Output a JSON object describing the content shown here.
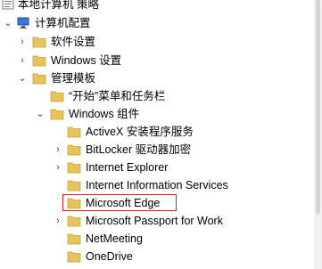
{
  "tree": {
    "items": [
      {
        "label": "本地计算机 策略",
        "icon": "policy-computer-icon",
        "expander": "none"
      },
      {
        "label": "计算机配置",
        "icon": "computer-config-icon",
        "expander": "expanded"
      },
      {
        "label": "软件设置",
        "icon": "folder-icon",
        "expander": "collapsed"
      },
      {
        "label": "Windows 设置",
        "icon": "folder-icon",
        "expander": "collapsed"
      },
      {
        "label": "管理模板",
        "icon": "folder-icon",
        "expander": "expanded"
      },
      {
        "label": "“开始”菜单和任务栏",
        "icon": "folder-icon",
        "expander": "none"
      },
      {
        "label": "Windows 组件",
        "icon": "folder-icon",
        "expander": "expanded"
      },
      {
        "label": "ActiveX 安装程序服务",
        "icon": "folder-icon",
        "expander": "none"
      },
      {
        "label": "BitLocker 驱动器加密",
        "icon": "folder-icon",
        "expander": "collapsed"
      },
      {
        "label": "Internet Explorer",
        "icon": "folder-icon",
        "expander": "collapsed"
      },
      {
        "label": "Internet Information Services",
        "icon": "folder-icon",
        "expander": "none"
      },
      {
        "label": "Microsoft Edge",
        "icon": "folder-icon",
        "expander": "none",
        "selected": true
      },
      {
        "label": "Microsoft Passport for Work",
        "icon": "folder-icon",
        "expander": "collapsed"
      },
      {
        "label": "NetMeeting",
        "icon": "folder-icon",
        "expander": "none"
      },
      {
        "label": "OneDrive",
        "icon": "folder-icon",
        "expander": "none"
      }
    ]
  },
  "colors": {
    "folder": "#e8c25a",
    "selection_border": "#e02020"
  }
}
